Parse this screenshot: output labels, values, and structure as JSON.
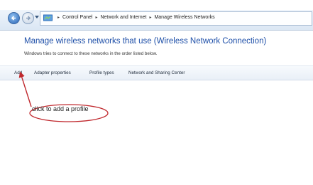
{
  "address_bar": {
    "breadcrumbs": [
      "Control Panel",
      "Network and Internet",
      "Manage Wireless Networks"
    ],
    "separator": "▸"
  },
  "page": {
    "title": "Manage wireless networks that use (Wireless Network Connection)",
    "description": "Windows tries to connect to these networks in the order listed below."
  },
  "commands": {
    "add": "Add",
    "adapter_properties": "Adapter properties",
    "profile_types": "Profile types",
    "network_sharing_center": "Network and Sharing Center"
  },
  "annotation": {
    "callout_text": "click to add a profile",
    "color": "#c0282d"
  },
  "icons": {
    "back": "back-arrow-icon",
    "forward": "forward-arrow-icon",
    "history": "dropdown-arrow-icon",
    "location": "control-panel-icon"
  }
}
